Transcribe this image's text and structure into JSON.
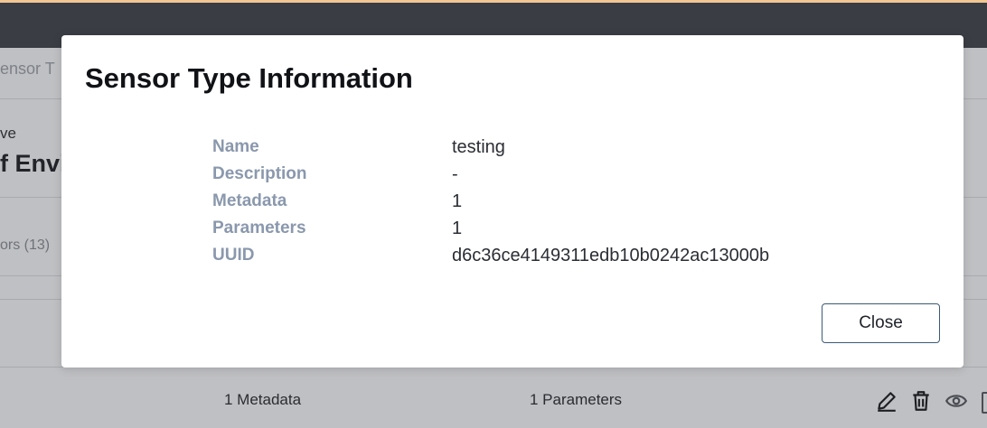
{
  "background": {
    "breadcrumb_fragment": "ensor T",
    "subtitle_fragment": "ve",
    "title_fragment": "f Envi",
    "tab_fragment": "ors (13)",
    "row": {
      "metadata_label": "1 Metadata",
      "parameters_label": "1 Parameters"
    },
    "icons": [
      "edit-icon",
      "trash-icon",
      "eye-icon"
    ]
  },
  "modal": {
    "title": "Sensor Type Information",
    "rows": [
      {
        "label": "Name",
        "value": "testing"
      },
      {
        "label": "Description",
        "value": "-"
      },
      {
        "label": "Metadata",
        "value": "1"
      },
      {
        "label": "Parameters",
        "value": "1"
      },
      {
        "label": "UUID",
        "value": "d6c36ce4149311edb10b0242ac13000b"
      }
    ],
    "close_label": "Close"
  },
  "colors": {
    "appbar": "#3a3d44",
    "overlay": "#bfc0c3",
    "label": "#8a98ad",
    "button_border": "#3c5a78"
  }
}
